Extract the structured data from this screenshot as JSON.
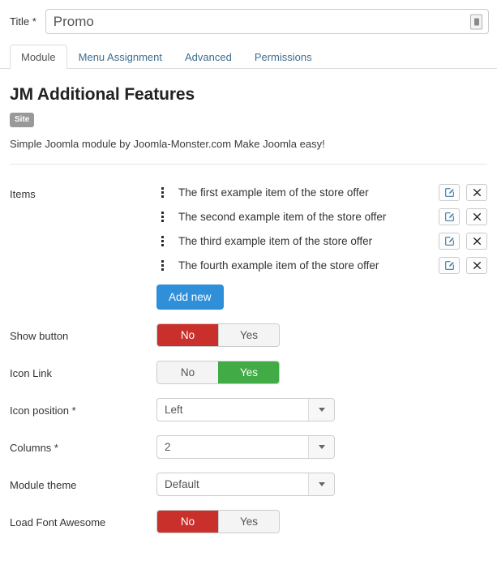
{
  "title_field": {
    "label": "Title *",
    "value": "Promo",
    "placeholder": "",
    "addon_icon": "article-picker-icon"
  },
  "tabs": [
    {
      "label": "Module",
      "active": true
    },
    {
      "label": "Menu Assignment",
      "active": false
    },
    {
      "label": "Advanced",
      "active": false
    },
    {
      "label": "Permissions",
      "active": false
    }
  ],
  "module": {
    "heading": "JM Additional Features",
    "badge": "Site",
    "description": "Simple Joomla module by Joomla-Monster.com Make Joomla easy!"
  },
  "items_field": {
    "label": "Items",
    "items": [
      {
        "text": "The first example item of the store offer"
      },
      {
        "text": "The second example item of the store offer"
      },
      {
        "text": "The third example item of the store offer"
      },
      {
        "text": "The fourth example item of the store offer"
      }
    ],
    "edit_icon": "pencil-square-icon",
    "delete_icon": "close-x-icon",
    "drag_icon": "drag-dots-vertical-icon",
    "add_button": "Add new"
  },
  "fields": [
    {
      "label": "Show button",
      "type": "toggle",
      "options": [
        "No",
        "Yes"
      ],
      "selected": "No"
    },
    {
      "label": "Icon Link",
      "type": "toggle",
      "options": [
        "No",
        "Yes"
      ],
      "selected": "Yes"
    },
    {
      "label": "Icon position *",
      "type": "select",
      "value": "Left"
    },
    {
      "label": "Columns *",
      "type": "select",
      "value": "2"
    },
    {
      "label": "Module theme",
      "type": "select",
      "value": "Default"
    },
    {
      "label": "Load Font Awesome",
      "type": "toggle",
      "options": [
        "No",
        "Yes"
      ],
      "selected": "No"
    }
  ],
  "colors": {
    "accent_blue": "#2f8fd8",
    "toggle_no_red": "#c9302c",
    "toggle_yes_green": "#41ab45",
    "badge_grey": "#999999",
    "tab_link": "#3e6d8e"
  }
}
